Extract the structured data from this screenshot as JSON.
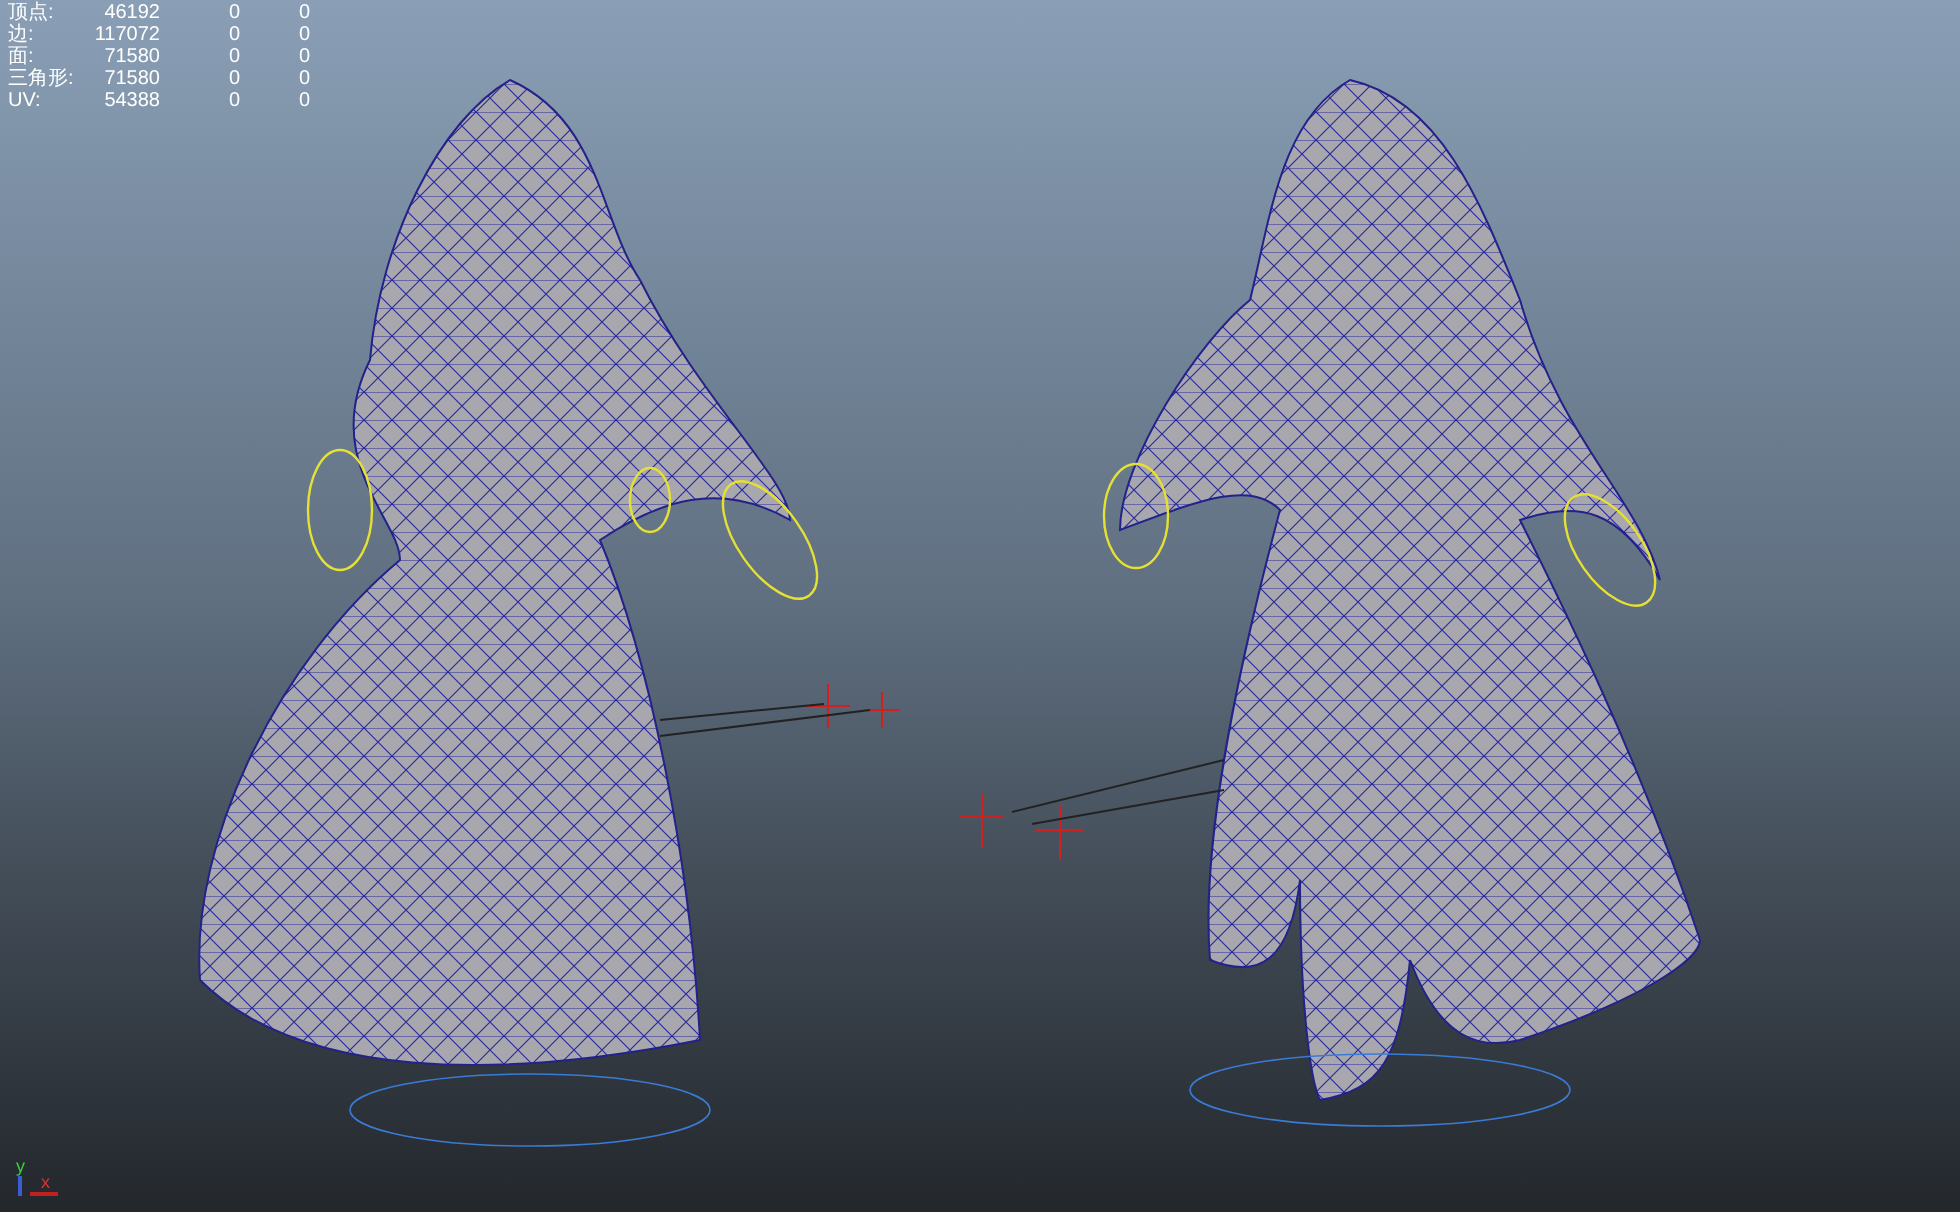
{
  "hud": {
    "rows": [
      {
        "label": "顶点:",
        "value": "46192",
        "column_3": "0",
        "column_4": "0"
      },
      {
        "label": "边:",
        "value": "117072",
        "column_3": "0",
        "column_4": "0"
      },
      {
        "label": "面:",
        "value": "71580",
        "column_3": "0",
        "column_4": "0"
      },
      {
        "label": "三角形:",
        "value": "71580",
        "column_3": "0",
        "column_4": "0"
      },
      {
        "label": "UV:",
        "value": "54388",
        "column_3": "0",
        "column_4": "0"
      }
    ]
  },
  "axis": {
    "y_label": "y",
    "x_label": "x"
  }
}
